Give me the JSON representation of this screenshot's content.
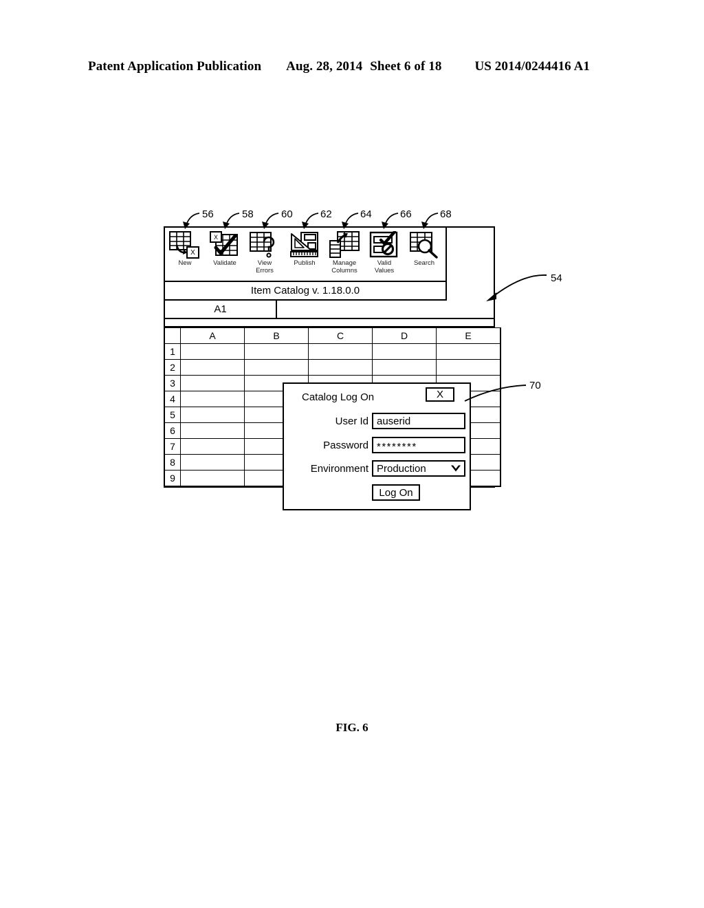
{
  "page_header": {
    "publication": "Patent Application Publication",
    "date": "Aug. 28, 2014",
    "sheet": "Sheet 6 of 18",
    "patent_number": "US 2014/0244416 A1"
  },
  "figure": {
    "caption": "FIG. 6",
    "reference_numerals": [
      {
        "id": "56",
        "label": "56",
        "target": "new-tool"
      },
      {
        "id": "58",
        "label": "58",
        "target": "validate-tool"
      },
      {
        "id": "60",
        "label": "60",
        "target": "view-errors-tool"
      },
      {
        "id": "62",
        "label": "62",
        "target": "publish-tool"
      },
      {
        "id": "64",
        "label": "64",
        "target": "manage-columns-tool"
      },
      {
        "id": "66",
        "label": "66",
        "target": "valid-values-tool"
      },
      {
        "id": "68",
        "label": "68",
        "target": "search-tool"
      },
      {
        "id": "54",
        "label": "54",
        "target": "app-window"
      },
      {
        "id": "70",
        "label": "70",
        "target": "logon-dialog"
      }
    ]
  },
  "app": {
    "title": "Item Catalog v. 1.18.0.0",
    "toolbar": {
      "buttons": [
        {
          "label": "New",
          "icon": "grid-new-icon"
        },
        {
          "label": "Validate",
          "icon": "grid-check-icon"
        },
        {
          "label": "View\nErrors",
          "icon": "grid-question-icon"
        },
        {
          "label": "Publish",
          "icon": "ruler-publish-icon"
        },
        {
          "label": "Manage\nColumns",
          "icon": "grid-columns-icon"
        },
        {
          "label": "Valid\nValues",
          "icon": "check-prohibit-icon"
        },
        {
          "label": "Search",
          "icon": "grid-magnifier-icon"
        }
      ]
    },
    "formula_bar": {
      "name_box_value": "A1",
      "formula_value": ""
    },
    "sheet": {
      "column_headers": [
        "A",
        "B",
        "C",
        "D",
        "E"
      ],
      "row_headers": [
        "1",
        "2",
        "3",
        "4",
        "5",
        "6",
        "7",
        "8",
        "9"
      ],
      "cells": [
        [
          "",
          "",
          "",
          "",
          ""
        ],
        [
          "",
          "",
          "",
          "",
          ""
        ],
        [
          "",
          "",
          "",
          "",
          ""
        ],
        [
          "",
          "",
          "",
          "",
          ""
        ],
        [
          "",
          "",
          "",
          "",
          ""
        ],
        [
          "",
          "",
          "",
          "",
          ""
        ],
        [
          "",
          "",
          "",
          "",
          ""
        ],
        [
          "",
          "",
          "",
          "",
          ""
        ],
        [
          "",
          "",
          "",
          "",
          ""
        ]
      ]
    }
  },
  "dialog": {
    "title": "Catalog Log On",
    "close_label": "X",
    "fields": [
      {
        "label": "User Id",
        "value": "auserid",
        "type": "text"
      },
      {
        "label": "Password",
        "value": "********",
        "type": "password"
      },
      {
        "label": "Environment",
        "value": "Production",
        "type": "select"
      }
    ],
    "submit_label": "Log On"
  }
}
